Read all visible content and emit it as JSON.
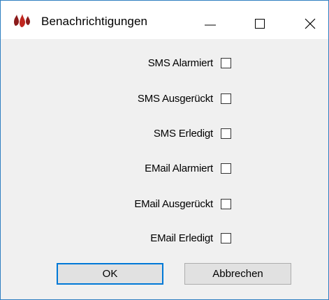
{
  "window": {
    "title": "Benachrichtigungen",
    "controls": {
      "minimize_icon": "minimize-icon",
      "maximize_icon": "maximize-icon",
      "close_icon": "close-icon"
    },
    "accent": "#0078d7"
  },
  "options": [
    {
      "label": "SMS Alarmiert",
      "checked": false
    },
    {
      "label": "SMS Ausgerückt",
      "checked": false
    },
    {
      "label": "SMS Erledigt",
      "checked": false
    },
    {
      "label": "EMail Alarmiert",
      "checked": false
    },
    {
      "label": "EMail Ausgerückt",
      "checked": false
    },
    {
      "label": "EMail Erledigt",
      "checked": false
    }
  ],
  "buttons": {
    "ok_label": "OK",
    "cancel_label": "Abbrechen"
  }
}
